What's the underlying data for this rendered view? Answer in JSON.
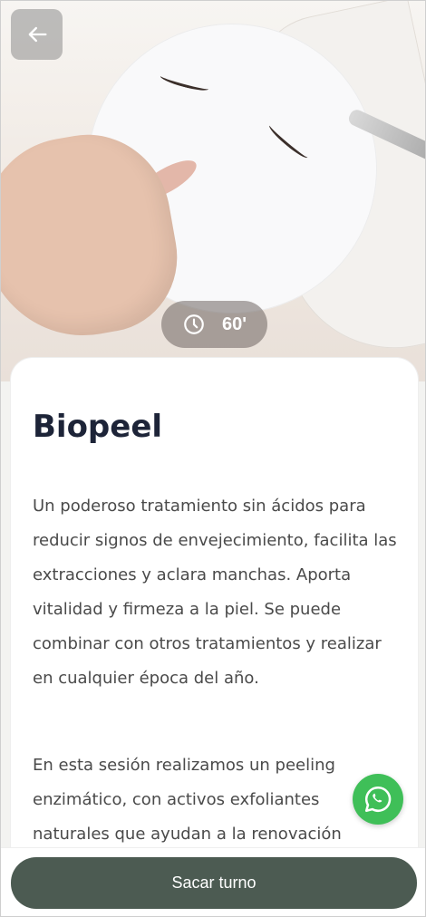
{
  "header": {
    "back_icon": "arrow-left-icon"
  },
  "service": {
    "duration": "60'",
    "duration_icon": "clock-icon",
    "title": "Biopeel",
    "paragraphs": [
      "Un poderoso tratamiento sin ácidos para reducir signos de envejecimiento, facilita las extracciones y aclara manchas. Aporta vitalidad y firmeza a la piel. Se puede combinar con otros tratamientos y realizar en cualquier época del año.",
      "En esta sesión realizamos un peeling enzimático, con activos exfoliantes naturales que ayudan a la renovación"
    ]
  },
  "actions": {
    "cta_label": "Sacar turno",
    "whatsapp_icon": "whatsapp-icon"
  },
  "colors": {
    "title": "#1d2438",
    "text": "#4a4a4a",
    "cta_bg": "#4c5b52",
    "whatsapp": "#3fbf58"
  }
}
